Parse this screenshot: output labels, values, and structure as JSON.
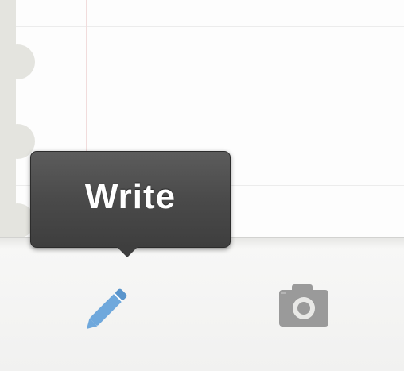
{
  "tooltip": {
    "label": "Write"
  },
  "tabbar": {
    "tabs": [
      {
        "name": "write",
        "icon": "pencil-icon",
        "selected": true,
        "color": "#6fa8dc"
      },
      {
        "name": "photo",
        "icon": "camera-icon",
        "selected": false,
        "color": "#9a9a9a"
      }
    ]
  },
  "colors": {
    "paper": "#fdfdfd",
    "margin_line": "#f1dcdc",
    "tooltip_bg": "#4a4a4a",
    "tabbar_bg": "#f2f2f0"
  }
}
